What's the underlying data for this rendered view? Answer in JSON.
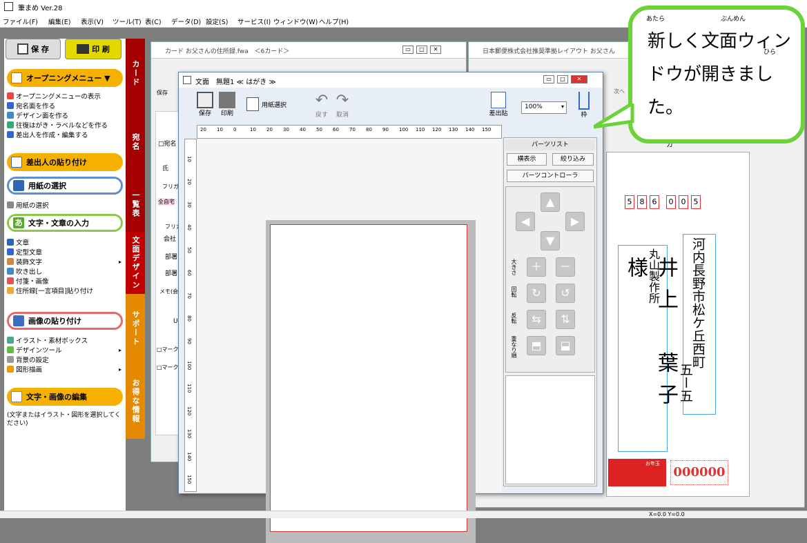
{
  "app": {
    "title": "筆まめ Ver.28"
  },
  "menu": [
    "ファイル(F)",
    "編集(E)",
    "表示(V)",
    "ツール(T)",
    "表(C)",
    "データ(D)",
    "設定(S)",
    "サービス(I)",
    "ウィンドウ(W)",
    "ヘルプ(H)"
  ],
  "left": {
    "save": "保 存",
    "print": "印 刷",
    "opening_menu": "オープニングメニュー ▼",
    "items1": [
      "オープニングメニューの表示",
      "宛名面を作る",
      "デザイン面を作る",
      "往復はがき・ラベルなどを作る",
      "差出人を作成・編集する"
    ],
    "sender_paste": "差出人の貼り付け",
    "paper_select": "用紙の選択",
    "paper_select_item": "用紙の選択",
    "text_input": "文字・文章の入力",
    "items2": [
      "文章",
      "定型文章",
      "装飾文字",
      "吹き出し",
      "付箋・画像",
      "住所録[一言項目]貼り付け"
    ],
    "image_paste": "画像の貼り付け",
    "items3": [
      "イラスト・素材ボックス",
      "デザインツール",
      "背景の設定",
      "図形描画"
    ],
    "edit": "文字・画像の編集",
    "edit_note": "(文字またはイラスト・図形を選択してください)"
  },
  "sidetabs": [
    "カード",
    "宛名",
    "一覧表",
    "文面デザイン",
    "サポート",
    "お得な情報"
  ],
  "bg_window1": {
    "title": "カード お父さんの住所録.fwa　＜6カード＞",
    "labels": [
      "保存",
      "□宛名",
      "氏",
      "フリガ",
      "全自宅",
      "フリガ",
      "会社",
      "部署",
      "部署",
      "メモ(会",
      "U",
      "□マーク",
      "□マーク"
    ]
  },
  "bg_window2": {
    "title": "日本郵便株式会社推奨準拠レイアウト お父さん",
    "next": "次へ",
    "card": "カ"
  },
  "front": {
    "title": "文面　無題1 ≪ はがき ≫",
    "save": "保存",
    "print": "印刷",
    "paper_select": "用紙選択",
    "undo": "戻す",
    "cancel": "取消",
    "sender_paste": "差出貼",
    "zoom": "100%",
    "frame": "枠",
    "ruler": [
      "20",
      "10",
      "0",
      "10",
      "20",
      "30",
      "40",
      "50",
      "60",
      "70",
      "80",
      "90",
      "100",
      "110",
      "120",
      "130",
      "140",
      "150"
    ],
    "vruler": [
      "10",
      "20",
      "30",
      "40",
      "50",
      "60",
      "70",
      "80",
      "90",
      "100",
      "110",
      "120",
      "130",
      "140",
      "150"
    ],
    "parts_list": "パーツリスト",
    "horizontal": "横表示",
    "filter": "絞り込み",
    "parts_controller": "パーツコントローラ",
    "size": "大きさ",
    "rotate": "回転",
    "flip": "反転",
    "order": "重なり順"
  },
  "callout": {
    "text": "新しく文面ウィンドウが開きました。",
    "ruby": [
      "あたら",
      "ぶんめん",
      "ひら"
    ]
  },
  "postcard": {
    "zip": [
      "5",
      "8",
      "6",
      "0",
      "0",
      "5"
    ],
    "address1": "河内長野市松ケ丘西町",
    "address2": "五ー五",
    "company": "丸山製作所",
    "name": "井上　葉子　様",
    "stamp": "お年玉",
    "number": "000000"
  },
  "status": {
    "coords": "X=0.0 Y=0.0"
  }
}
